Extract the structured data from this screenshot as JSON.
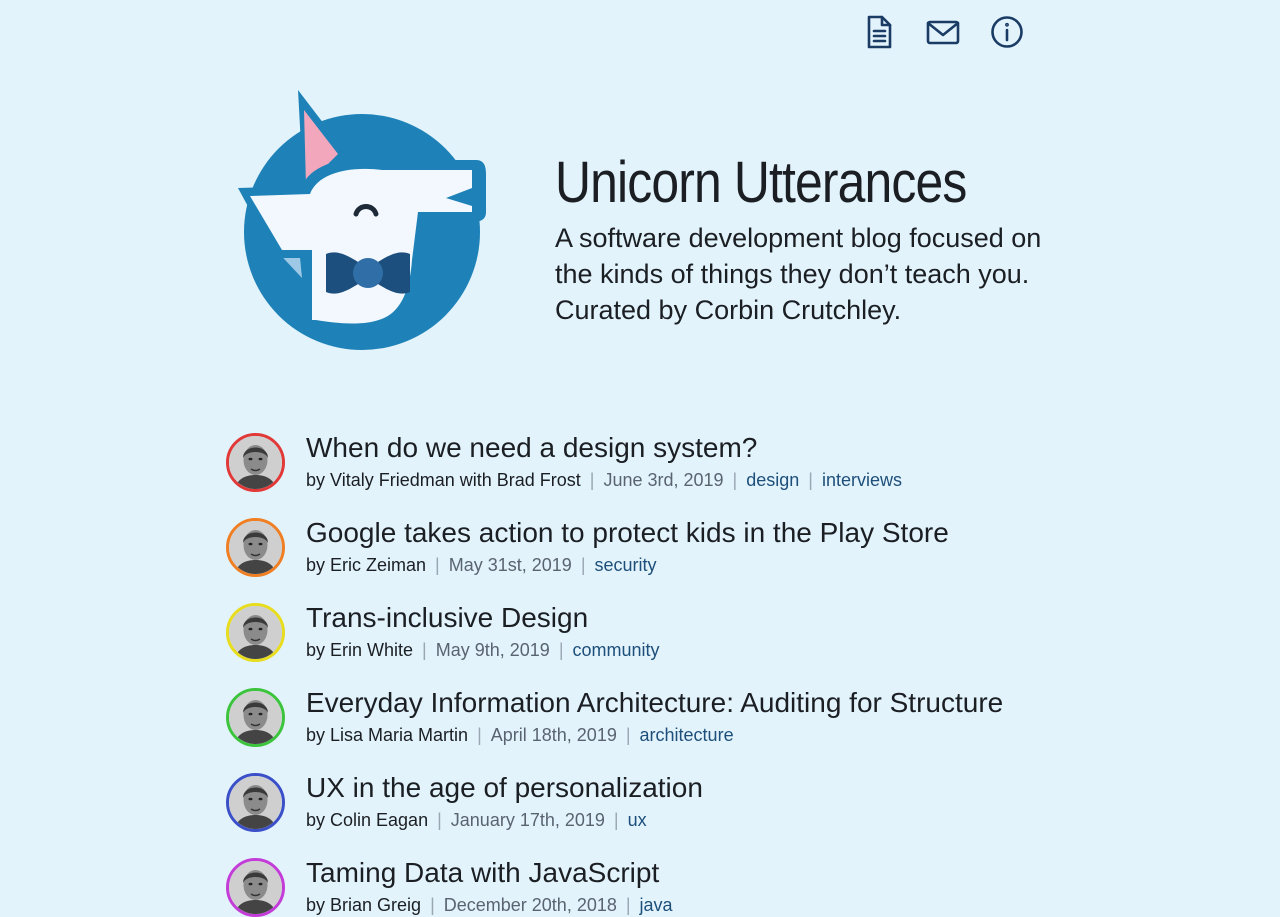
{
  "header": {
    "title": "Unicorn Utterances",
    "description": "A software development blog focused on the kinds of things they don’t teach you. Curated by Corbin Crutchley."
  },
  "topnav": [
    {
      "icon": "document-icon",
      "label": "Blog posts"
    },
    {
      "icon": "mail-icon",
      "label": "Contact"
    },
    {
      "icon": "info-icon",
      "label": "About"
    }
  ],
  "colors": {
    "background": "#e2f3fc",
    "text": "#1b1f23",
    "link": "#1d4f7a",
    "logo_blue": "#1e82b8"
  },
  "posts": [
    {
      "title": "When do we need a design system?",
      "author": "by Vitaly Friedman with Brad Frost",
      "date": "June 3rd, 2019",
      "tags": [
        "design",
        "interviews"
      ],
      "ring": "#e13838"
    },
    {
      "title": "Google takes action to protect kids in the Play Store",
      "author": "by Eric Zeiman",
      "date": "May 31st, 2019",
      "tags": [
        "security"
      ],
      "ring": "#f07f23"
    },
    {
      "title": "Trans-inclusive Design",
      "author": "by Erin White",
      "date": "May 9th, 2019",
      "tags": [
        "community"
      ],
      "ring": "#e8dc1e"
    },
    {
      "title": "Everyday Information Architecture: Auditing for Structure",
      "author": "by Lisa Maria Martin",
      "date": "April 18th, 2019",
      "tags": [
        "architecture"
      ],
      "ring": "#3cc43c"
    },
    {
      "title": "UX in the age of personalization",
      "author": "by Colin Eagan",
      "date": "January 17th, 2019",
      "tags": [
        "ux"
      ],
      "ring": "#3a4fc8"
    },
    {
      "title": "Taming Data with JavaScript",
      "author": "by Brian Greig",
      "date": "December 20th, 2018",
      "tags": [
        "java"
      ],
      "ring": "#c43cd8"
    }
  ]
}
